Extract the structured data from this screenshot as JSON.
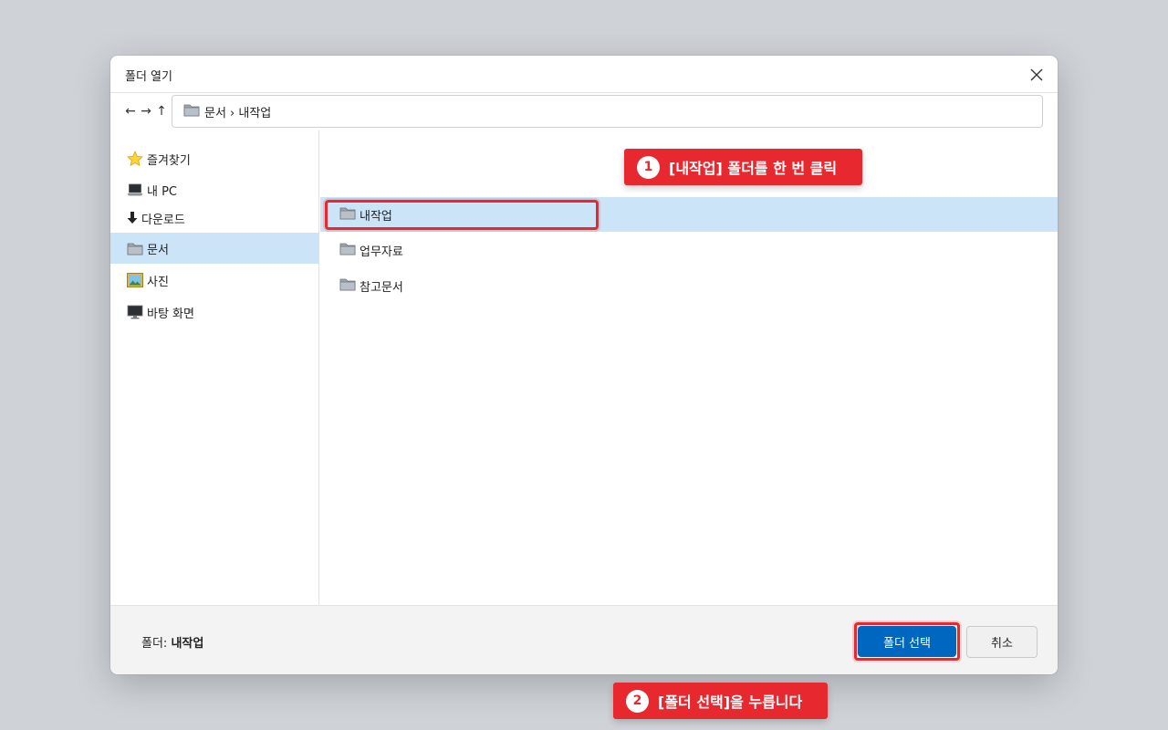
{
  "dialog": {
    "title": "폴더 열기"
  },
  "toolbar": {
    "back_glyph": "←",
    "forward_glyph": "→",
    "up_glyph": "↑",
    "path": "문서 › 내작업"
  },
  "sidebar": {
    "items": [
      {
        "label": "즐겨찾기",
        "icon": "star-icon"
      },
      {
        "label": "내 PC",
        "icon": "laptop-icon"
      },
      {
        "label": "다운로드",
        "icon": "download-icon"
      },
      {
        "label": "문서",
        "icon": "folder-icon",
        "active": true
      },
      {
        "label": "사진",
        "icon": "picture-icon"
      },
      {
        "label": "바탕 화면",
        "icon": "desktop-icon"
      }
    ]
  },
  "files": [
    {
      "name": "내작업",
      "selected": true
    },
    {
      "name": "업무자료",
      "selected": false
    },
    {
      "name": "참고문서",
      "selected": false
    }
  ],
  "footer": {
    "folder_label": "폴더:",
    "folder_value": "내작업",
    "select_button": "폴더 선택",
    "cancel_button": "취소"
  },
  "callouts": {
    "step1_num": "1",
    "step1_text": "[내작업] 폴더를 한 번 클릭",
    "step2_num": "2",
    "step2_text": "[폴더 선택]을 누릅니다"
  },
  "colors": {
    "accent": "#0067c0",
    "selection": "#cce4f7",
    "highlight": "#e8282f",
    "background": "#cfd3d8"
  }
}
